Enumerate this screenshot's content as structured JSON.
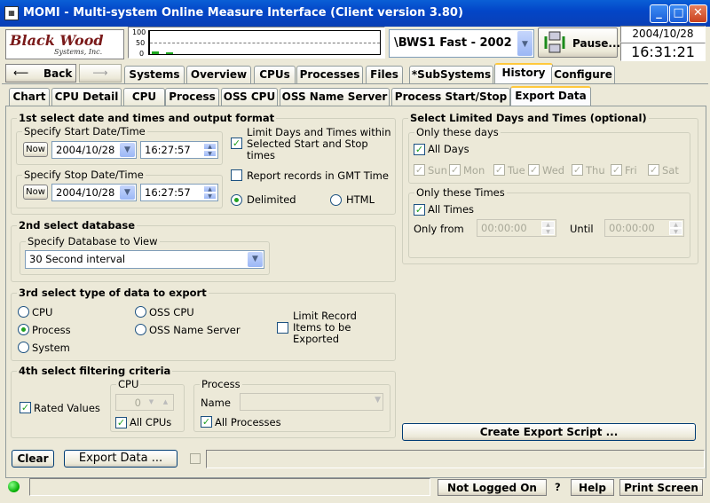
{
  "window": {
    "title": "MOMI - Multi-system Online Measure Interface (Client version 3.80)",
    "icon": "app-icon"
  },
  "header": {
    "logo_line1": "Black Wood",
    "logo_line2": "Systems, Inc.",
    "graph_scale": [
      "100",
      "50",
      "0"
    ],
    "system_select": "\\BWS1 Fast - 2002",
    "pause_label": "Pause...",
    "date": "2004/10/28",
    "time": "16:31:21"
  },
  "nav": {
    "back": "Back",
    "tabs": [
      "Systems",
      "Overview",
      "CPUs",
      "Processes",
      "Files",
      "*SubSystems",
      "History",
      "Configure"
    ],
    "selected": "History"
  },
  "subtabs": {
    "items": [
      "Chart",
      "CPU Detail",
      "CPU",
      "Process",
      "OSS CPU",
      "OSS Name Server",
      "Process Start/Stop",
      "Export Data"
    ],
    "selected": "Export Data"
  },
  "section1": {
    "title": "1st select date and times and output format",
    "start_group": "Specify Start Date/Time",
    "start_now": "Now",
    "start_date": "2004/10/28",
    "start_time": "16:27:57",
    "stop_group": "Specify Stop Date/Time",
    "stop_now": "Now",
    "stop_date": "2004/10/28",
    "stop_time": "16:27:57",
    "limit_days": "Limit Days and Times within Selected Start and Stop times",
    "gmt": "Report records in GMT Time",
    "delimited": "Delimited",
    "html": "HTML"
  },
  "section2": {
    "title": "2nd select database",
    "group": "Specify Database to View",
    "value": "30 Second interval"
  },
  "section3": {
    "title": "3rd select type of data to export",
    "options": [
      "CPU",
      "Process",
      "System",
      "OSS CPU",
      "OSS Name Server"
    ],
    "selected": "Process",
    "limit": "Limit Record Items to be Exported"
  },
  "section4": {
    "title": "4th select filtering criteria",
    "rated": "Rated Values",
    "cpu_group": "CPU",
    "cpu_value": "0",
    "all_cpus": "All CPUs",
    "process_group": "Process",
    "name_label": "Name",
    "all_processes": "All Processes"
  },
  "limited": {
    "title": "Select Limited Days and Times (optional)",
    "days_group": "Only these days",
    "all_days": "All Days",
    "days": [
      "Sun",
      "Mon",
      "Tue",
      "Wed",
      "Thu",
      "Fri",
      "Sat"
    ],
    "times_group": "Only these Times",
    "all_times": "All Times",
    "from_label": "Only from",
    "from_value": "00:00:00",
    "until_label": "Until",
    "until_value": "00:00:00"
  },
  "buttons": {
    "create_script": "Create Export Script ...",
    "clear": "Clear",
    "export": "Export Data ..."
  },
  "status": {
    "login": "Not Logged On",
    "help_q": "?",
    "help": "Help",
    "print": "Print Screen"
  }
}
